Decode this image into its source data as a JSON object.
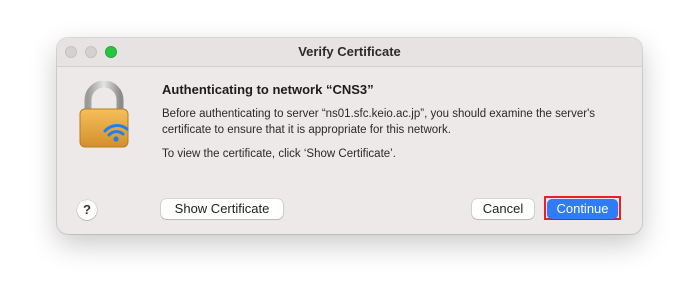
{
  "window": {
    "title": "Verify Certificate"
  },
  "dialog": {
    "heading": "Authenticating to network “CNS3”",
    "message": "Before authenticating to server “ns01.sfc.keio.ac.jp”, you should examine the server's certificate to ensure that it is appropriate for this network.",
    "hint": "To view the certificate, click ‘Show Certificate’.",
    "icon": "wifi-lock-icon"
  },
  "buttons": {
    "help_label": "?",
    "show_certificate_label": "Show Certificate",
    "cancel_label": "Cancel",
    "continue_label": "Continue"
  },
  "colors": {
    "accent": "#2f7cf6",
    "highlight_outline": "#e8202d",
    "zoom_button": "#2bc440"
  }
}
